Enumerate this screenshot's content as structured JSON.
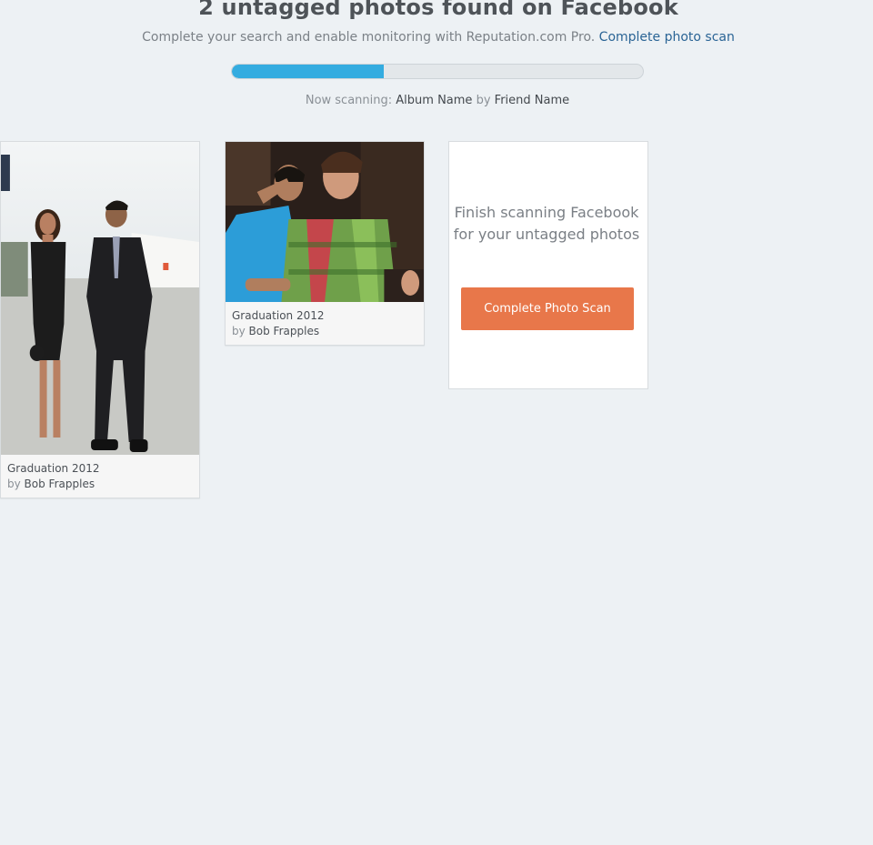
{
  "header": {
    "title": "2 untagged photos found on Facebook",
    "subtitle_text": "Complete your search and enable monitoring with Reputation.com Pro.",
    "subtitle_link": "Complete photo scan"
  },
  "progress": {
    "value": 0.37,
    "color": "#34ace0"
  },
  "scan_status": {
    "prefix": "Now scanning:",
    "album": "Album Name",
    "by": "by",
    "friend": "Friend Name"
  },
  "photos": [
    {
      "title": "Graduation 2012",
      "by": "by",
      "author": "Bob Frapples"
    },
    {
      "title": "Graduation 2012",
      "by": "by",
      "author": "Bob Frapples"
    }
  ],
  "cta": {
    "text": "Finish scanning Facebook for your untagged photos",
    "button_label": "Complete Photo Scan",
    "button_color": "#e8774a"
  }
}
